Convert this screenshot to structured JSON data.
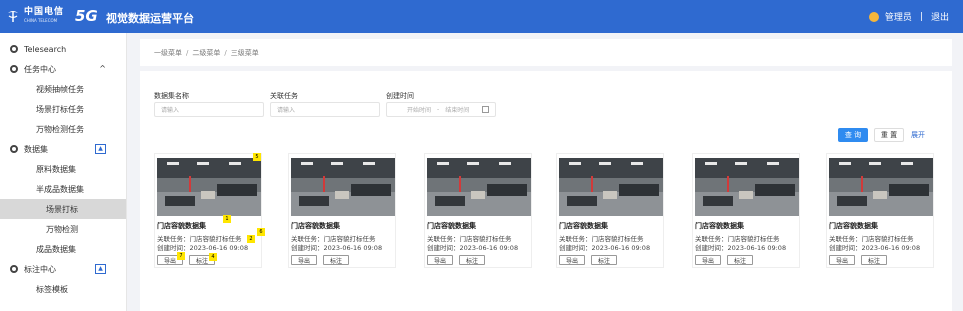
{
  "header": {
    "brand_text": "中国电信",
    "brand_sub": "CHINA TELECOM",
    "fiveg": "5G",
    "app_title": "视觉数据运营平台",
    "user_name": "管理员",
    "separator": "|",
    "logout": "退出"
  },
  "sidebar": {
    "items": [
      {
        "label": "Telesearch",
        "level": "group",
        "icon": "globe-icon"
      },
      {
        "label": "任务中心",
        "level": "group",
        "icon": "globe-icon",
        "expand": "^"
      },
      {
        "label": "视频抽帧任务",
        "level": "sub"
      },
      {
        "label": "场景打标任务",
        "level": "sub"
      },
      {
        "label": "万物检测任务",
        "level": "sub"
      },
      {
        "label": "数据集",
        "level": "group",
        "icon": "globe-icon",
        "toggle": "▲"
      },
      {
        "label": "原料数据集",
        "level": "sub"
      },
      {
        "label": "半成品数据集",
        "level": "sub"
      },
      {
        "label": "场景打标",
        "level": "sub2",
        "active": true
      },
      {
        "label": "万物检测",
        "level": "sub2"
      },
      {
        "label": "成品数据集",
        "level": "sub"
      },
      {
        "label": "标注中心",
        "level": "group",
        "icon": "globe-icon",
        "toggle": "▲"
      },
      {
        "label": "标签模板",
        "level": "sub"
      }
    ]
  },
  "breadcrumb": [
    "一级菜单",
    "二级菜单",
    "三级菜单"
  ],
  "filters": {
    "name_label": "数据集名称",
    "name_placeholder": "请输入",
    "task_label": "关联任务",
    "task_placeholder": "请输入",
    "time_label": "创建时间",
    "start_placeholder": "开始时间",
    "end_placeholder": "结束时间",
    "range_sep": "-"
  },
  "actions": {
    "query": "查 询",
    "reset": "重 置",
    "expand": "展开"
  },
  "cards": [
    {
      "title": "门店容貌数据集",
      "task": "关联任务：门店容貌打标任务",
      "created": "创建时间：2023-06-16 09:08",
      "btn_a": "导出",
      "btn_b": "标注"
    },
    {
      "title": "门店容貌数据集",
      "task": "关联任务：门店容貌打标任务",
      "created": "创建时间：2023-06-16 09:08",
      "btn_a": "导出",
      "btn_b": "标注"
    },
    {
      "title": "门店容貌数据集",
      "task": "关联任务：门店容貌打标任务",
      "created": "创建时间：2023-06-16 09:08",
      "btn_a": "导出",
      "btn_b": "标注"
    },
    {
      "title": "门店容貌数据集",
      "task": "关联任务：门店容貌打标任务",
      "created": "创建时间：2023-06-16 09:08",
      "btn_a": "导出",
      "btn_b": "标注"
    },
    {
      "title": "门店容貌数据集",
      "task": "关联任务：门店容貌打标任务",
      "created": "创建时间：2023-06-16 09:08",
      "btn_a": "导出",
      "btn_b": "标注"
    },
    {
      "title": "门店容貌数据集",
      "task": "关联任务：门店容貌打标任务",
      "created": "创建时间：2023-06-16 09:08",
      "btn_a": "导出",
      "btn_b": "标注"
    }
  ],
  "markers": [
    "5",
    "1",
    "2",
    "6",
    "7",
    "4"
  ],
  "colors": {
    "header_bg": "#2f6ad0",
    "accent": "#2f8bf0",
    "marker": "#ffe600",
    "active_item": "#d8d8d8"
  }
}
